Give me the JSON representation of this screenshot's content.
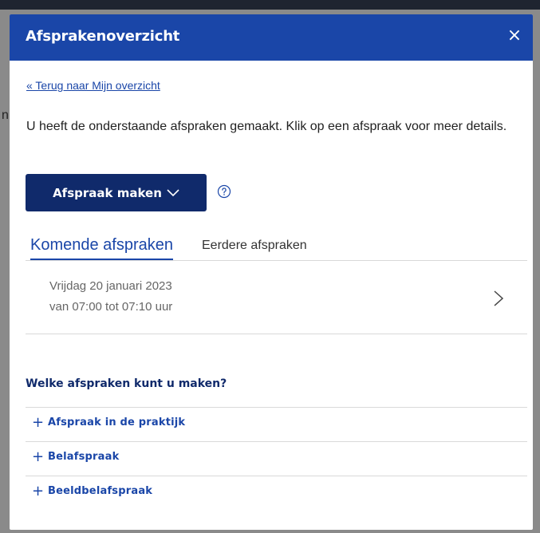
{
  "backdrop": {
    "partial_char": "n"
  },
  "dialog": {
    "title": "Afsprakenoverzicht",
    "close_glyph": "×",
    "back_link": "« Terug naar Mijn overzicht",
    "intro": "U heeft de onderstaande afspraken gemaakt. Klik op een afspraak voor meer details.",
    "make_button": "Afspraak maken",
    "icons": {
      "close": "close-icon",
      "chevron_down": "chevron-down-icon",
      "help": "help-circle-icon",
      "chevron_right": "chevron-right-icon",
      "plus": "plus-icon"
    },
    "tabs": [
      {
        "label": "Komende afspraken",
        "active": true
      },
      {
        "label": "Eerdere afspraken",
        "active": false
      }
    ],
    "appointments": [
      {
        "date": "Vrijdag 20 januari 2023",
        "time": "van 07:00 tot 07:10 uur"
      }
    ],
    "section_title": "Welke afspraken kunt u maken?",
    "options": [
      {
        "plus": "+",
        "label": "Afspraak in de praktijk"
      },
      {
        "plus": "+",
        "label": "Belafspraak"
      },
      {
        "plus": "+",
        "label": "Beeldbelafspraak"
      }
    ]
  },
  "colors": {
    "header_blue": "#1a46a8",
    "button_navy": "#102a6b",
    "link_blue": "#1a46a8",
    "divider": "#d9d9d9",
    "muted_text": "#666666"
  }
}
